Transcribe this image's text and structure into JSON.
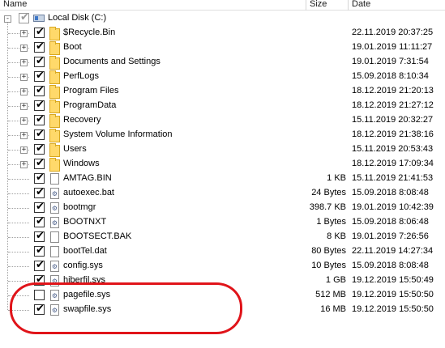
{
  "columns": {
    "name": "Name",
    "size": "Size",
    "date": "Date"
  },
  "root": {
    "label": "Local Disk (C:)",
    "icon": "drive-icon",
    "expander": "-"
  },
  "items": [
    {
      "name": "$Recycle.Bin",
      "icon": "folder-icon",
      "checked": true,
      "expandable": true,
      "size": "",
      "date": "22.11.2019 20:37:25"
    },
    {
      "name": "Boot",
      "icon": "folder-icon",
      "checked": true,
      "expandable": true,
      "size": "",
      "date": "19.01.2019 11:11:27"
    },
    {
      "name": "Documents and Settings",
      "icon": "folder-icon",
      "checked": true,
      "expandable": true,
      "size": "",
      "date": "19.01.2019 7:31:54"
    },
    {
      "name": "PerfLogs",
      "icon": "folder-icon",
      "checked": true,
      "expandable": true,
      "size": "",
      "date": "15.09.2018 8:10:34"
    },
    {
      "name": "Program Files",
      "icon": "folder-icon",
      "checked": true,
      "expandable": true,
      "size": "",
      "date": "18.12.2019 21:20:13"
    },
    {
      "name": "ProgramData",
      "icon": "folder-icon",
      "checked": true,
      "expandable": true,
      "size": "",
      "date": "18.12.2019 21:27:12"
    },
    {
      "name": "Recovery",
      "icon": "folder-icon",
      "checked": true,
      "expandable": true,
      "size": "",
      "date": "15.11.2019 20:32:27"
    },
    {
      "name": "System Volume Information",
      "icon": "folder-icon",
      "checked": true,
      "expandable": true,
      "size": "",
      "date": "18.12.2019 21:38:16"
    },
    {
      "name": "Users",
      "icon": "folder-icon",
      "checked": true,
      "expandable": true,
      "size": "",
      "date": "15.11.2019 20:53:43"
    },
    {
      "name": "Windows",
      "icon": "folder-icon",
      "checked": true,
      "expandable": true,
      "size": "",
      "date": "18.12.2019 17:09:34"
    },
    {
      "name": "AMTAG.BIN",
      "icon": "file-icon",
      "checked": true,
      "expandable": false,
      "size": "1 KB",
      "date": "15.11.2019 21:41:53"
    },
    {
      "name": "autoexec.bat",
      "icon": "system-file-icon",
      "checked": true,
      "expandable": false,
      "size": "24 Bytes",
      "date": "15.09.2018 8:08:48"
    },
    {
      "name": "bootmgr",
      "icon": "system-file-icon",
      "checked": true,
      "expandable": false,
      "size": "398.7 KB",
      "date": "19.01.2019 10:42:39"
    },
    {
      "name": "BOOTNXT",
      "icon": "system-file-icon",
      "checked": true,
      "expandable": false,
      "size": "1 Bytes",
      "date": "15.09.2018 8:06:48"
    },
    {
      "name": "BOOTSECT.BAK",
      "icon": "file-icon",
      "checked": true,
      "expandable": false,
      "size": "8 KB",
      "date": "19.01.2019 7:26:56"
    },
    {
      "name": "bootTel.dat",
      "icon": "file-icon",
      "checked": true,
      "expandable": false,
      "size": "80 Bytes",
      "date": "22.11.2019 14:27:34"
    },
    {
      "name": "config.sys",
      "icon": "system-file-icon",
      "checked": true,
      "expandable": false,
      "size": "10 Bytes",
      "date": "15.09.2018 8:08:48"
    },
    {
      "name": "hiberfil.sys",
      "icon": "system-file-icon",
      "checked": true,
      "expandable": false,
      "size": "1 GB",
      "date": "19.12.2019 15:50:49"
    },
    {
      "name": "pagefile.sys",
      "icon": "system-file-icon",
      "checked": false,
      "expandable": false,
      "size": "512 MB",
      "date": "19.12.2019 15:50:50"
    },
    {
      "name": "swapfile.sys",
      "icon": "system-file-icon",
      "checked": true,
      "expandable": false,
      "size": "16 MB",
      "date": "19.12.2019 15:50:50"
    }
  ],
  "glyphs": {
    "check": "✔",
    "plus": "+",
    "gear": "⚙"
  },
  "colors": {
    "annotation": "#e0141a",
    "folder": "#ffd96b"
  }
}
